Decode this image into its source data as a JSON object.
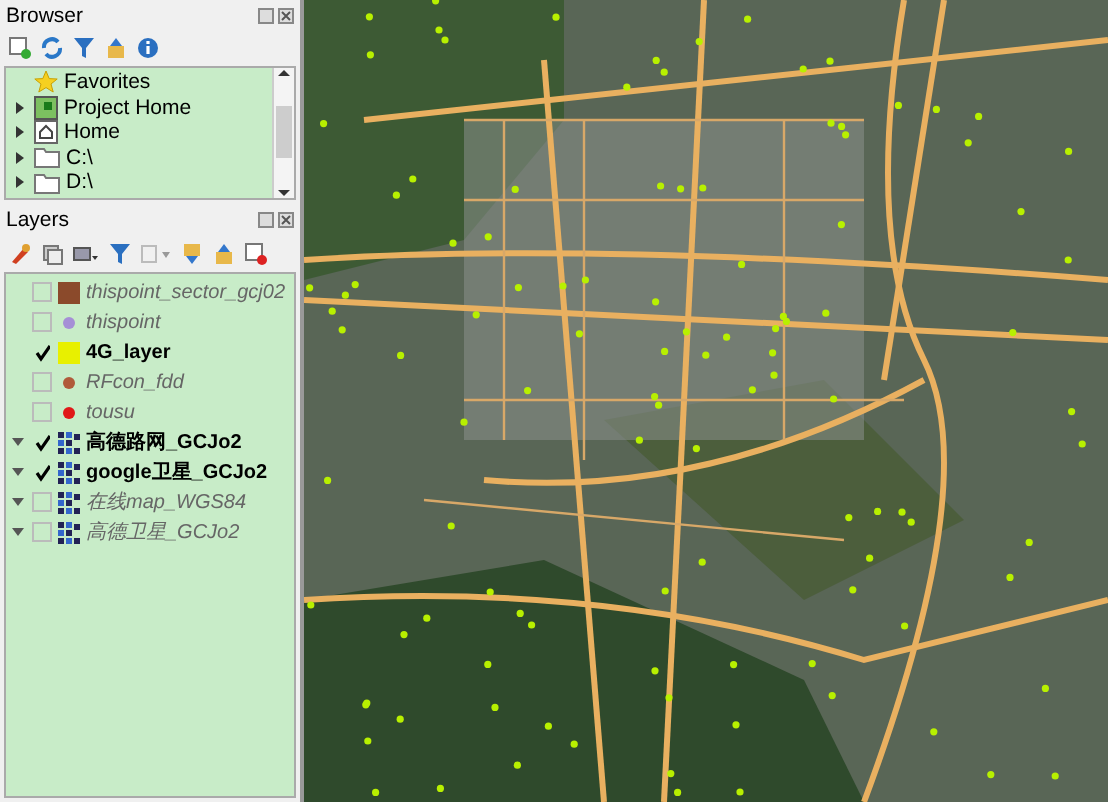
{
  "browser": {
    "title": "Browser",
    "items": [
      {
        "label": "Favorites",
        "kind": "favorites"
      },
      {
        "label": "Project Home",
        "kind": "project"
      },
      {
        "label": "Home",
        "kind": "home"
      },
      {
        "label": "C:\\",
        "kind": "drive"
      },
      {
        "label": "D:\\",
        "kind": "drive"
      }
    ]
  },
  "layers": {
    "title": "Layers",
    "items": [
      {
        "name": "thispoint_sector_gcj02",
        "kind": "polygon",
        "color": "#8b4a2b",
        "checked": false
      },
      {
        "name": "thispoint",
        "kind": "point",
        "color": "#a58fd6",
        "checked": false
      },
      {
        "name": "4G_layer",
        "kind": "polygon",
        "color": "#e8f000",
        "checked": true
      },
      {
        "name": "RFcon_fdd",
        "kind": "point",
        "color": "#b05a3a",
        "checked": false
      },
      {
        "name": "tousu",
        "kind": "point",
        "color": "#e01818",
        "checked": false
      },
      {
        "name": "高德路网_GCJo2",
        "kind": "raster",
        "checked": true
      },
      {
        "name": "google卫星_GCJo2",
        "kind": "raster",
        "checked": true
      },
      {
        "name": "在线map_WGS84",
        "kind": "raster",
        "checked": false
      },
      {
        "name": "高德卫星_GCJo2",
        "kind": "raster",
        "checked": false
      }
    ]
  }
}
